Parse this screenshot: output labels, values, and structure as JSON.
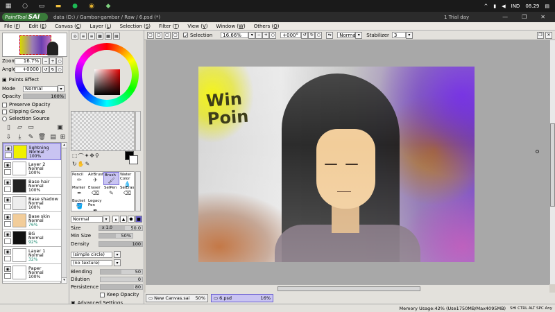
{
  "taskbar": {
    "icons": [
      "windows-icon",
      "search-icon",
      "task-view-icon",
      "file-explorer-icon",
      "spotify-icon",
      "chrome-icon",
      "sai-icon"
    ],
    "trial": "1 Trial day",
    "lang": "IND",
    "time": "08.29"
  },
  "titlebar": {
    "logo_text": "PaintTool",
    "logo_bold": "SAI",
    "path": "data (D:) / Gambar-gambar / Raw / 6.psd (*)"
  },
  "menu": [
    {
      "label": "File",
      "key": "F"
    },
    {
      "label": "Edit",
      "key": "E"
    },
    {
      "label": "Canvas",
      "key": "C"
    },
    {
      "label": "Layer",
      "key": "L"
    },
    {
      "label": "Selection",
      "key": "S"
    },
    {
      "label": "Filter",
      "key": "T"
    },
    {
      "label": "View",
      "key": "V"
    },
    {
      "label": "Window",
      "key": "W"
    },
    {
      "label": "Others",
      "key": "O"
    }
  ],
  "navigator": {
    "zoom_label": "Zoom",
    "zoom_value": "16.7%",
    "angle_label": "Angle",
    "angle_value": "+0000"
  },
  "layer_panel": {
    "paints_effect": "Paints Effect",
    "mode_label": "Mode",
    "mode_value": "Normal",
    "opacity_label": "Opacity",
    "opacity_value": "100%",
    "preserve_opacity": "Preserve Opacity",
    "clipping_group": "Clipping Group",
    "selection_source": "Selection Source"
  },
  "layers": [
    {
      "name": "lightning",
      "mode": "Normal",
      "opacity": "100%",
      "selected": true,
      "thumb": "#f0f000"
    },
    {
      "name": "Layer 2",
      "mode": "Normal",
      "opacity": "100%",
      "selected": false,
      "thumb": "#ffffff"
    },
    {
      "name": "Base hair",
      "mode": "Normal",
      "opacity": "100%",
      "selected": false,
      "thumb": "#222222"
    },
    {
      "name": "Base shadow",
      "mode": "Normal",
      "opacity": "100%",
      "selected": false,
      "thumb": "#eeeeee"
    },
    {
      "name": "Base skin",
      "mode": "Normal",
      "opacity": "76%",
      "selected": false,
      "thumb": "#f2cd9a"
    },
    {
      "name": "BG",
      "mode": "Normal",
      "opacity": "92%",
      "selected": false,
      "thumb": "#111111"
    },
    {
      "name": "Layer 1",
      "mode": "Normal",
      "opacity": "32%",
      "selected": false,
      "thumb": "#ffffff"
    },
    {
      "name": "Paper",
      "mode": "Normal",
      "opacity": "100%",
      "selected": false,
      "thumb": "#ffffff"
    }
  ],
  "tools": {
    "brushes": [
      {
        "name": "Pencil",
        "selected": false
      },
      {
        "name": "AirBrush",
        "selected": false
      },
      {
        "name": "Brush",
        "selected": true
      },
      {
        "name": "Water Color",
        "selected": false
      },
      {
        "name": "Marker",
        "selected": false
      },
      {
        "name": "Eraser",
        "selected": false
      },
      {
        "name": "SelPen",
        "selected": false
      },
      {
        "name": "SelEras",
        "selected": false
      },
      {
        "name": "Bucket",
        "selected": false
      },
      {
        "name": "Legacy Pen",
        "selected": false
      }
    ],
    "blend_mode": "Normal",
    "size_label": "Size",
    "size_mult": "x 1.0",
    "size_value": "50.0",
    "minsize_label": "Min Size",
    "minsize_value": "50%",
    "density_label": "Density",
    "density_value": "100",
    "shape": "(simple circle)",
    "texture": "(no texture)",
    "blending_label": "Blending",
    "blending_value": "50",
    "dilution_label": "Dilution",
    "dilution_value": "0",
    "persistence_label": "Persistence",
    "persistence_value": "80",
    "keep_opacity": "Keep Opacity",
    "advanced": "Advanced Settings"
  },
  "canvas_toolbar": {
    "selection_label": "Selection",
    "zoom": "16.66%",
    "angle": "+000°",
    "mode": "Normal",
    "stabilizer_label": "Stabilizer",
    "stabilizer_value": "3"
  },
  "artwork": {
    "text": "Win Poin"
  },
  "documents": [
    {
      "name": "New Canvas.sai",
      "zoom": "50%",
      "active": false
    },
    {
      "name": "6.psd",
      "zoom": "16%",
      "active": true
    }
  ],
  "status": {
    "memory": "Memory Usage:42% (Use1750MB/Max4095MB)",
    "indicators": "SHI CTRL ALT SPC Any"
  }
}
